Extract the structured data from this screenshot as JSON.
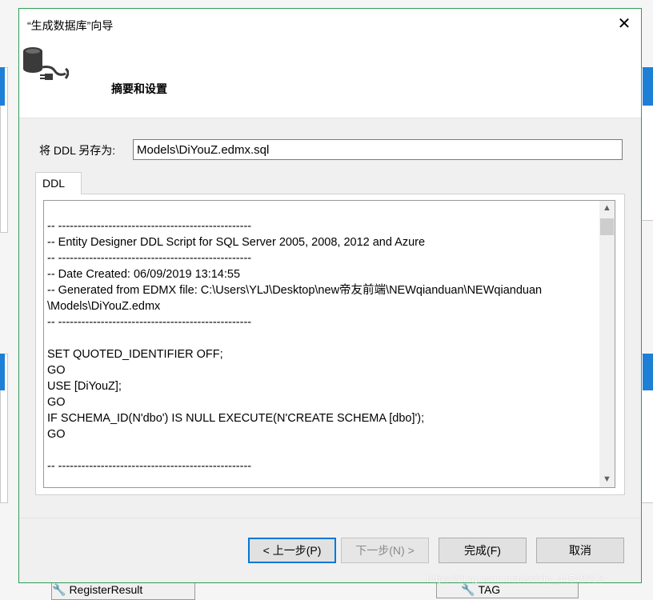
{
  "dialog": {
    "title": "“生成数据库”向导",
    "header_title": "摘要和设置",
    "save_as_label": "将 DDL 另存为:",
    "save_as_value": "Models\\DiYouZ.edmx.sql",
    "tab_label": "DDL",
    "ddl_lines": [
      "-- --------------------------------------------------",
      "-- Entity Designer DDL Script for SQL Server 2005, 2008, 2012 and Azure",
      "-- --------------------------------------------------",
      "-- Date Created: 06/09/2019 13:14:55",
      "-- Generated from EDMX file: C:\\Users\\YLJ\\Desktop\\new帝友前端\\NEWqianduan\\NEWqianduan",
      "\\Models\\DiYouZ.edmx",
      "-- --------------------------------------------------",
      "",
      "SET QUOTED_IDENTIFIER OFF;",
      "GO",
      "USE [DiYouZ];",
      "GO",
      "IF SCHEMA_ID(N'dbo') IS NULL EXECUTE(N'CREATE SCHEMA [dbo]');",
      "GO",
      "",
      "-- --------------------------------------------------"
    ],
    "buttons": {
      "prev": "< 上一步(P)",
      "next": "下一步(N) >",
      "finish": "完成(F)",
      "cancel": "取消"
    }
  },
  "background": {
    "entity_left": "RegisterResult",
    "entity_right": "TAG"
  },
  "watermark": "https://blog.csdn.net/weixin_44549313",
  "colors": {
    "dialog_border": "#2f9e57",
    "accent_blue": "#0078d7",
    "designer_blue": "#1e7fd6"
  }
}
